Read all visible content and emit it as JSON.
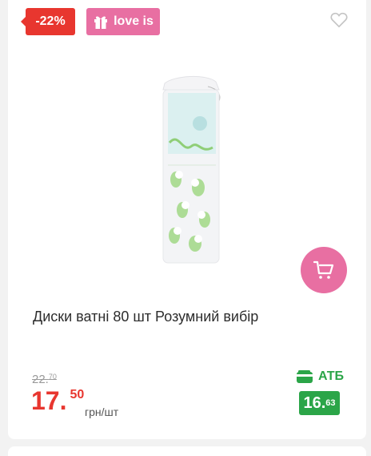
{
  "badges": {
    "discount": "-22%",
    "promo": "love is",
    "promo_icon": "gift-icon"
  },
  "product": {
    "title": "Диски ватні 80 шт Розумний вибір",
    "image": "cotton-pads-package"
  },
  "pricing": {
    "old_price_main": "22.",
    "old_price_cents": "70",
    "price_main": "17.",
    "price_cents": "50",
    "unit": "грн/шт",
    "store_name": "АТБ",
    "store_icon": "wallet-icon",
    "store_price_main": "16.",
    "store_price_cents": "63"
  },
  "actions": {
    "favorite_icon": "heart-icon",
    "cart_icon": "cart-icon"
  },
  "colors": {
    "discount_red": "#e8362f",
    "promo_pink": "#e86fa2",
    "store_green": "#2ba548"
  }
}
